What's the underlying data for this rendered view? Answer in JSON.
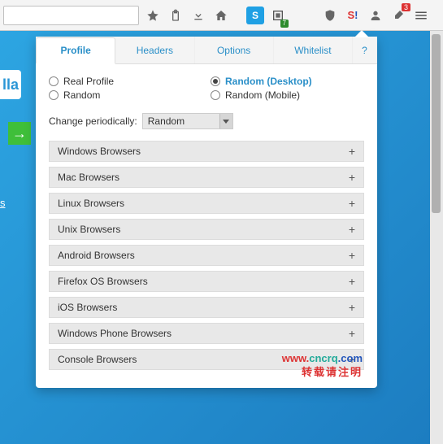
{
  "toolbar": {
    "badge_green": "7",
    "badge_red": "3"
  },
  "panel": {
    "tabs": {
      "profile": "Profile",
      "headers": "Headers",
      "options": "Options",
      "whitelist": "Whitelist",
      "help": "?"
    },
    "radios": {
      "real": "Real Profile",
      "random": "Random",
      "rand_desktop": "Random (Desktop)",
      "rand_mobile": "Random (Mobile)"
    },
    "period": {
      "label": "Change periodically:",
      "value": "Random"
    },
    "sections": [
      "Windows Browsers",
      "Mac Browsers",
      "Linux Browsers",
      "Unix Browsers",
      "Android Browsers",
      "Firefox OS Browsers",
      "iOS Browsers",
      "Windows Phone Browsers",
      "Console Browsers"
    ]
  },
  "watermark": {
    "l1a": "www.",
    "l1b": "cncrq",
    "l1c": ".com",
    "l2": "转载请注明"
  },
  "bg": {
    "corner": "lla",
    "link": "s",
    "text": ""
  }
}
